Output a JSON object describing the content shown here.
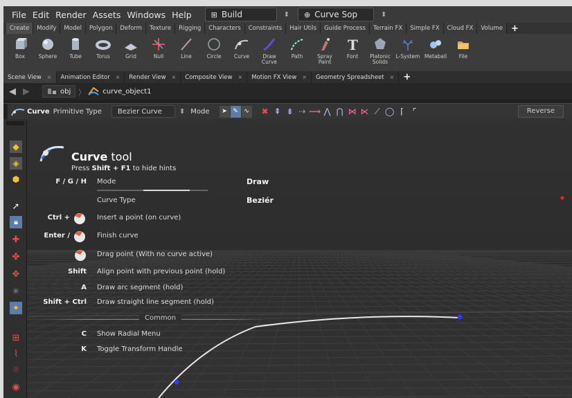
{
  "menu": {
    "items": [
      "File",
      "Edit",
      "Render",
      "Assets",
      "Windows",
      "Help"
    ],
    "desktop": "Build",
    "context": "Curve Sop"
  },
  "shelf_tabs": [
    "Create",
    "Modify",
    "Model",
    "Polygon",
    "Deform",
    "Texture",
    "Rigging",
    "Characters",
    "Constraints",
    "Hair Utils",
    "Guide Process",
    "Terrain FX",
    "Simple FX",
    "Cloud FX",
    "Volume"
  ],
  "tools": [
    {
      "label": "Box",
      "icon": "box-icon"
    },
    {
      "label": "Sphere",
      "icon": "sphere-icon"
    },
    {
      "label": "Tube",
      "icon": "tube-icon"
    },
    {
      "label": "Torus",
      "icon": "torus-icon"
    },
    {
      "label": "Grid",
      "icon": "grid-icon"
    },
    {
      "label": "Null",
      "icon": "null-icon"
    },
    {
      "label": "Line",
      "icon": "line-icon"
    },
    {
      "label": "Circle",
      "icon": "circle-icon"
    },
    {
      "label": "Curve",
      "icon": "curve-icon"
    },
    {
      "label": "Draw Curve",
      "icon": "draw-curve-icon"
    },
    {
      "label": "Path",
      "icon": "path-icon"
    },
    {
      "label": "Spray Paint",
      "icon": "spray-paint-icon"
    },
    {
      "label": "Font",
      "icon": "font-icon"
    },
    {
      "label": "Platonic Solids",
      "icon": "platonic-icon"
    },
    {
      "label": "L-System",
      "icon": "lsystem-icon"
    },
    {
      "label": "Metaball",
      "icon": "metaball-icon"
    },
    {
      "label": "File",
      "icon": "file-icon"
    }
  ],
  "pane_tabs": [
    "Scene View",
    "Animation Editor",
    "Render View",
    "Composite View",
    "Motion FX View",
    "Geometry Spreadsheet"
  ],
  "path": {
    "root": "obj",
    "node": "curve_object1"
  },
  "operator": {
    "name": "Curve",
    "primitive_label": "Primitive Type",
    "primitive_value": "Bezier Curve",
    "mode_label": "Mode",
    "reverse_label": "Reverse"
  },
  "hints": {
    "title_bold": "Curve",
    "title_rest": " tool",
    "press": "Press ",
    "shortcut": "Shift + F1",
    "press_rest": " to hide hints",
    "mode_keys": "F / G / H",
    "mode_label": "Mode",
    "mode_value": "Draw",
    "type_label": "Curve Type",
    "type_value": "Beziér",
    "rows": [
      {
        "key": "Ctrl +",
        "text": "Insert a point (on curve)"
      },
      {
        "key": "Enter /",
        "text": "Finish curve"
      },
      {
        "key": "",
        "text": "Drag point (With no curve active)"
      },
      {
        "key": "Shift",
        "text": "Align point with previous point (hold)"
      },
      {
        "key": "A",
        "text": "Draw arc segment (hold)"
      },
      {
        "key": "Shift + Ctrl",
        "text": "Draw straight line segment (hold)"
      }
    ],
    "section": "Common",
    "common": [
      {
        "key": "C",
        "text": "Show Radial Menu"
      },
      {
        "key": "K",
        "text": "Toggle Transform Handle"
      }
    ]
  },
  "colors": {
    "accent": "#5d7ca8",
    "curve": "#e8e8e8",
    "point": "#2a3cff",
    "marker": "#ff2020"
  }
}
